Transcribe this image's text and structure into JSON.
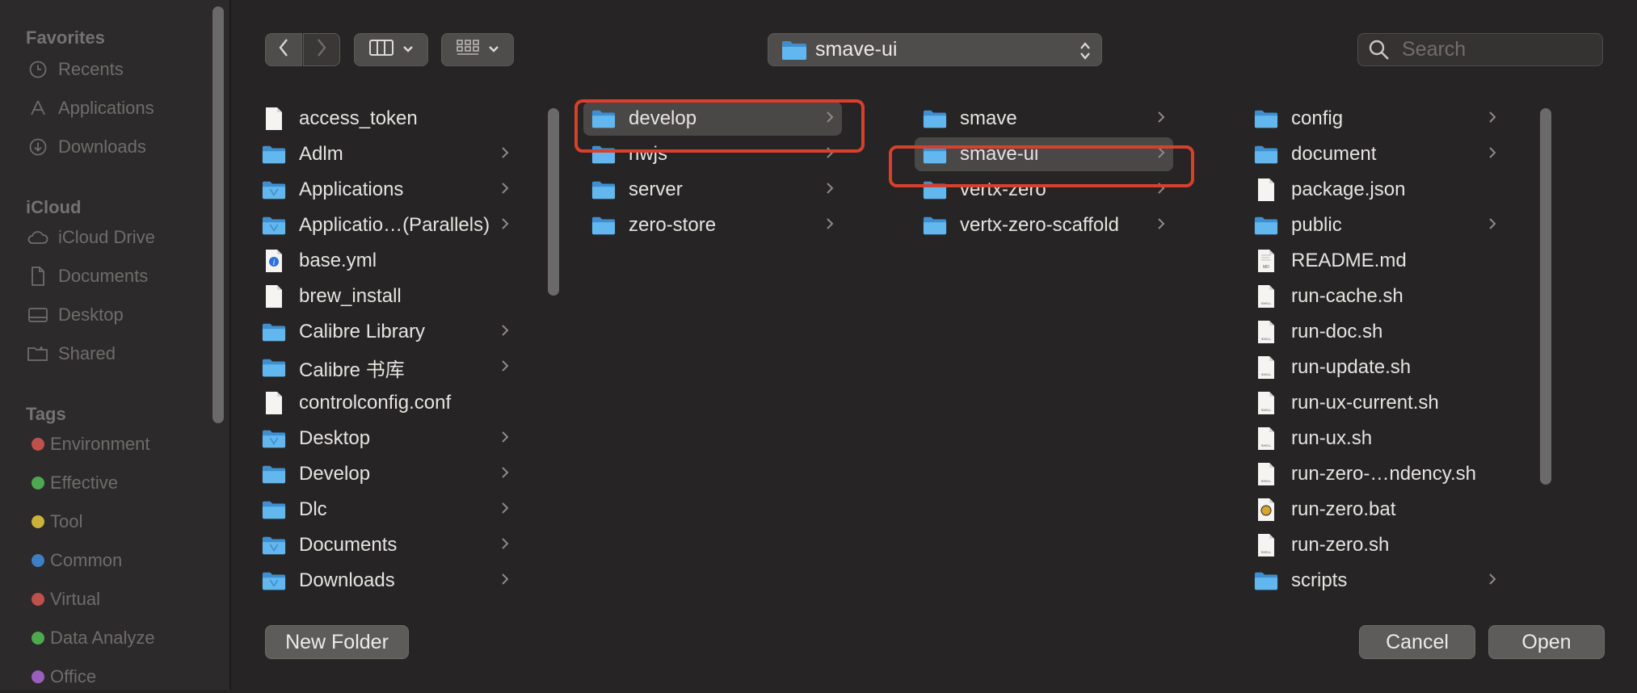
{
  "sidebar": {
    "favorites_heading": "Favorites",
    "favorites": [
      {
        "label": "Recents",
        "icon": "clock-icon"
      },
      {
        "label": "Applications",
        "icon": "applications-icon"
      },
      {
        "label": "Downloads",
        "icon": "download-icon"
      }
    ],
    "icloud_heading": "iCloud",
    "icloud": [
      {
        "label": "iCloud Drive",
        "icon": "cloud-icon"
      },
      {
        "label": "Documents",
        "icon": "document-icon"
      },
      {
        "label": "Desktop",
        "icon": "desktop-icon"
      },
      {
        "label": "Shared",
        "icon": "shared-folder-icon"
      }
    ],
    "tags_heading": "Tags",
    "tags": [
      {
        "label": "Environment",
        "color": "#c0504c"
      },
      {
        "label": "Effective",
        "color": "#4da852"
      },
      {
        "label": "Tool",
        "color": "#c9b13a"
      },
      {
        "label": "Common",
        "color": "#3d7ec4"
      },
      {
        "label": "Virtual",
        "color": "#c0504c"
      },
      {
        "label": "Data Analyze",
        "color": "#4da852"
      },
      {
        "label": "Office",
        "color": "#9a5fbd"
      }
    ]
  },
  "toolbar": {
    "back_icon": "chevron-left-icon",
    "forward_icon": "chevron-right-icon",
    "view_icon": "column-view-icon",
    "group_icon": "grid-icon",
    "path_label": "smave-ui",
    "search_placeholder": "Search"
  },
  "columns": [
    {
      "items": [
        {
          "name": "access_token",
          "kind": "file",
          "has_children": false
        },
        {
          "name": "Adlm",
          "kind": "folder",
          "has_children": true
        },
        {
          "name": "Applications",
          "kind": "folder-app",
          "has_children": true
        },
        {
          "name": "Applicatio…(Parallels)",
          "kind": "folder-app",
          "has_children": true
        },
        {
          "name": "base.yml",
          "kind": "file-info",
          "has_children": false
        },
        {
          "name": "brew_install",
          "kind": "file",
          "has_children": false
        },
        {
          "name": "Calibre Library",
          "kind": "folder",
          "has_children": true
        },
        {
          "name": "Calibre 书库",
          "kind": "folder",
          "has_children": true
        },
        {
          "name": "controlconfig.conf",
          "kind": "file",
          "has_children": false
        },
        {
          "name": "Desktop",
          "kind": "folder-app",
          "has_children": true
        },
        {
          "name": "Develop",
          "kind": "folder",
          "has_children": true
        },
        {
          "name": "Dlc",
          "kind": "folder",
          "has_children": true
        },
        {
          "name": "Documents",
          "kind": "folder-app",
          "has_children": true
        },
        {
          "name": "Downloads",
          "kind": "folder-app",
          "has_children": true
        }
      ]
    },
    {
      "items": [
        {
          "name": "develop",
          "kind": "folder",
          "has_children": true,
          "selected": true
        },
        {
          "name": "nwjs",
          "kind": "folder",
          "has_children": true
        },
        {
          "name": "server",
          "kind": "folder",
          "has_children": true
        },
        {
          "name": "zero-store",
          "kind": "folder",
          "has_children": true
        }
      ]
    },
    {
      "items": [
        {
          "name": "smave",
          "kind": "folder",
          "has_children": true
        },
        {
          "name": "smave-ui",
          "kind": "folder",
          "has_children": true,
          "selected": true
        },
        {
          "name": "vertx-zero",
          "kind": "folder",
          "has_children": true
        },
        {
          "name": "vertx-zero-scaffold",
          "kind": "folder",
          "has_children": true
        }
      ]
    },
    {
      "items": [
        {
          "name": "config",
          "kind": "folder",
          "has_children": true
        },
        {
          "name": "document",
          "kind": "folder",
          "has_children": true
        },
        {
          "name": "package.json",
          "kind": "file",
          "has_children": false
        },
        {
          "name": "public",
          "kind": "folder",
          "has_children": true
        },
        {
          "name": "README.md",
          "kind": "file-md",
          "has_children": false
        },
        {
          "name": "run-cache.sh",
          "kind": "file-shell",
          "has_children": false
        },
        {
          "name": "run-doc.sh",
          "kind": "file-shell",
          "has_children": false
        },
        {
          "name": "run-update.sh",
          "kind": "file-shell",
          "has_children": false
        },
        {
          "name": "run-ux-current.sh",
          "kind": "file-shell",
          "has_children": false
        },
        {
          "name": "run-ux.sh",
          "kind": "file-shell",
          "has_children": false
        },
        {
          "name": "run-zero-…ndency.sh",
          "kind": "file-shell",
          "has_children": false
        },
        {
          "name": "run-zero.bat",
          "kind": "file-bat",
          "has_children": false
        },
        {
          "name": "run-zero.sh",
          "kind": "file-shell",
          "has_children": false
        },
        {
          "name": "scripts",
          "kind": "folder",
          "has_children": true
        }
      ]
    }
  ],
  "buttons": {
    "new_folder": "New Folder",
    "cancel": "Cancel",
    "open": "Open"
  },
  "colors": {
    "folder_blue": "#5fb3ea",
    "highlight": "#d9402c"
  }
}
